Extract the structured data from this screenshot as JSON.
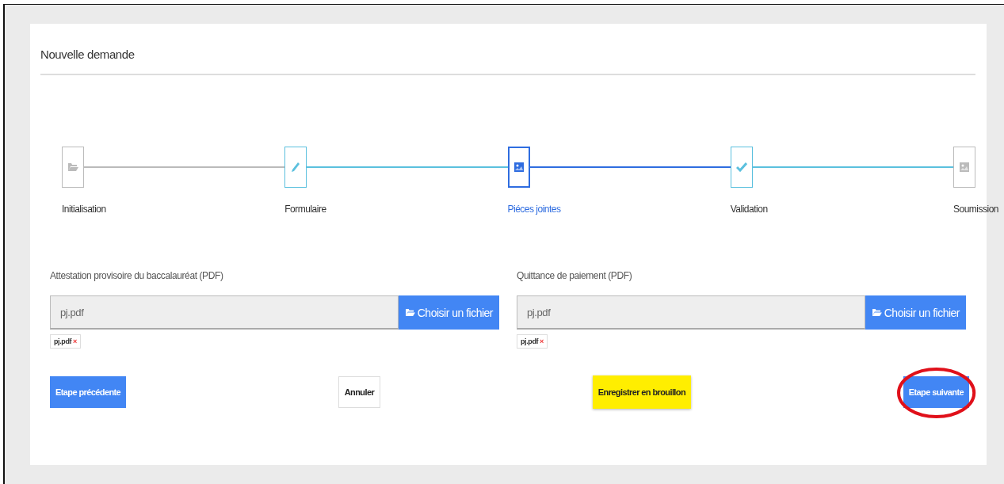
{
  "card": {
    "title": "Nouvelle demande"
  },
  "steps": [
    {
      "label": "Initialisation",
      "kind": "folder",
      "completed": false,
      "selected": false
    },
    {
      "label": "Formulaire",
      "kind": "pencil",
      "completed": true,
      "selected": false
    },
    {
      "label": "Piéces jointes",
      "kind": "image",
      "completed": false,
      "selected": true
    },
    {
      "label": "Validation",
      "kind": "check",
      "completed": true,
      "selected": false
    },
    {
      "label": "Soumission",
      "kind": "image",
      "completed": false,
      "selected": false
    }
  ],
  "connectors": [
    {
      "kind": "plain"
    },
    {
      "kind": "done"
    },
    {
      "kind": "active"
    },
    {
      "kind": "done"
    }
  ],
  "uploads": [
    {
      "label": "Attestation provisoire du baccalauréat (PDF)",
      "value": "pj.pdf",
      "button": "Choisir un fichier",
      "chip": "pj.pdf",
      "chip_remove": "×"
    },
    {
      "label": "Quittance de paiement (PDF)",
      "value": "pj.pdf",
      "button": "Choisir un fichier",
      "chip": "pj.pdf",
      "chip_remove": "×"
    }
  ],
  "actions": [
    {
      "label": "Etape précédente",
      "kind": "primary",
      "highlighted": false
    },
    {
      "label": "Annuler",
      "kind": "plain",
      "highlighted": false
    },
    {
      "label": "Enregistrer en brouillon",
      "kind": "draft",
      "highlighted": false
    },
    {
      "label": "Etape suivante",
      "kind": "primary",
      "highlighted": true
    }
  ]
}
